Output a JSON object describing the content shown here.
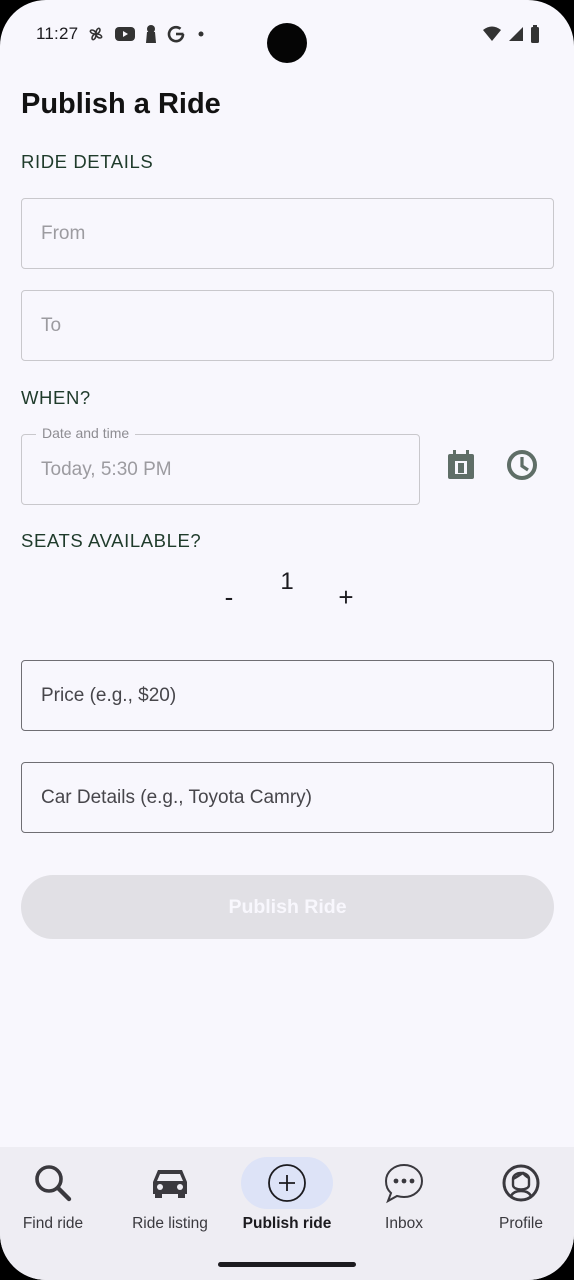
{
  "status_bar": {
    "time": "11:27",
    "left_icons": [
      "pinwheel-icon",
      "youtube-icon",
      "keyhole-icon",
      "google-icon",
      "dot-icon"
    ],
    "right_icons": [
      "wifi-icon",
      "signal-icon",
      "battery-icon"
    ]
  },
  "page": {
    "title": "Publish a Ride"
  },
  "ride_details": {
    "section_label": "RIDE DETAILS",
    "from_placeholder": "From",
    "to_placeholder": "To"
  },
  "when": {
    "section_label": "WHEN?",
    "date_label": "Date and time",
    "date_value": "Today, 5:30 PM",
    "calendar_icon": "calendar-icon",
    "clock_icon": "clock-icon"
  },
  "seats": {
    "section_label": "SEATS AVAILABLE?",
    "decrement_label": "-",
    "value": "1",
    "increment_label": "+"
  },
  "price": {
    "placeholder": "Price (e.g., $20)"
  },
  "car": {
    "placeholder": "Car Details (e.g., Toyota Camry)"
  },
  "publish_button": {
    "label": "Publish Ride",
    "enabled": false
  },
  "bottom_nav": {
    "items": [
      {
        "label": "Find ride",
        "icon": "search-icon",
        "active": false
      },
      {
        "label": "Ride listing",
        "icon": "car-icon",
        "active": false
      },
      {
        "label": "Publish ride",
        "icon": "add-circle-icon",
        "active": true
      },
      {
        "label": "Inbox",
        "icon": "chat-bubble-icon",
        "active": false
      },
      {
        "label": "Profile",
        "icon": "profile-icon",
        "active": false
      }
    ]
  },
  "colors": {
    "background": "#f8f7fd",
    "section_label": "#1f3b2b",
    "active_nav_pill": "#dde3f7",
    "disabled_button": "#e1e0e5"
  }
}
